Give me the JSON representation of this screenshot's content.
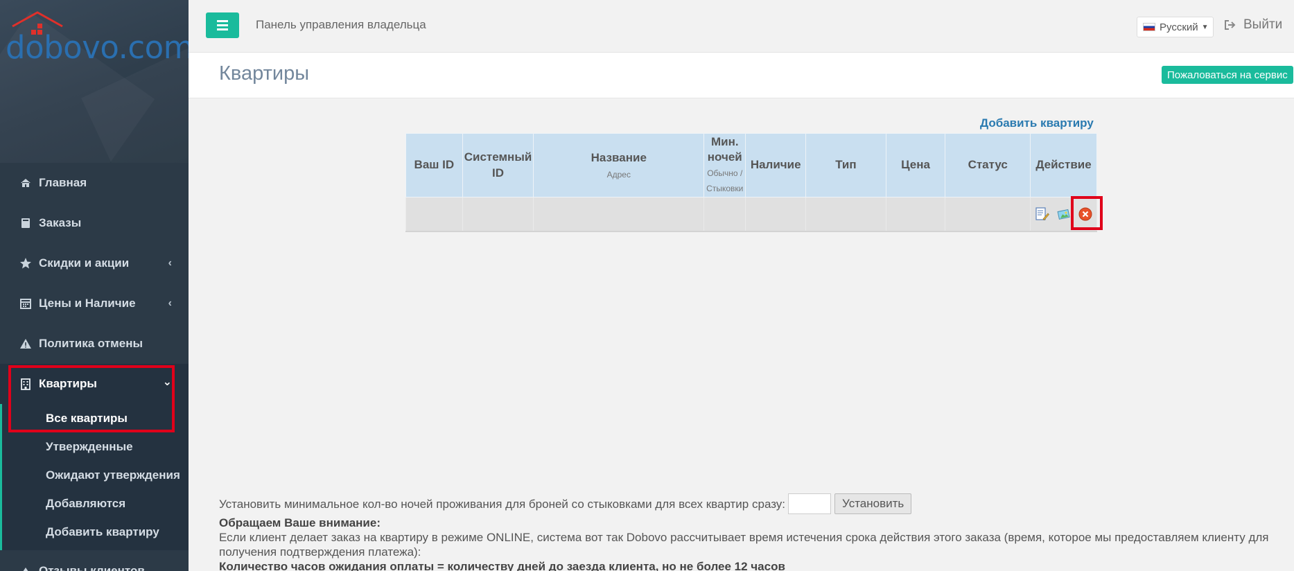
{
  "brand": {
    "logo_text": "dobovo.com"
  },
  "topbar": {
    "panel_title": "Панель управления владельца",
    "language": "Русский",
    "logout": "Выйти"
  },
  "page": {
    "title": "Квартиры",
    "complain_button": "Пожаловаться на сервис"
  },
  "sidebar": {
    "items": [
      {
        "label": "Главная",
        "icon": "home-icon"
      },
      {
        "label": "Заказы",
        "icon": "book-icon"
      },
      {
        "label": "Скидки и акции",
        "icon": "star-icon",
        "chevron": "‹"
      },
      {
        "label": "Цены и Наличие",
        "icon": "calendar-icon",
        "chevron": "‹"
      },
      {
        "label": "Политика отмены",
        "icon": "warning-icon"
      },
      {
        "label": "Квартиры",
        "icon": "building-icon",
        "chevron": "⌄"
      }
    ],
    "submenu": [
      "Все квартиры",
      "Утвержденные",
      "Ожидают утверждения",
      "Добавляются",
      "Добавить квартиру"
    ],
    "next_item": "Отзывы клиентов"
  },
  "table": {
    "add_link": "Добавить квартиру",
    "headers": {
      "your_id": "Ваш ID",
      "system_id": "Системный ID",
      "name": "Название",
      "name_sub": "Адрес",
      "min_nights": "Мин. ночей",
      "min_nights_sub": "Обычно / Стыковки",
      "availability": "Наличие",
      "type": "Тип",
      "price": "Цена",
      "status": "Статус",
      "action": "Действие"
    },
    "action_icons": [
      "edit-document-icon",
      "photo-icon",
      "delete-icon"
    ]
  },
  "bottom": {
    "min_nights_label": "Установить минимальное кол-во ночей проживания для броней со стыковками для всех квартир сразу:",
    "min_nights_value": "",
    "set_button": "Установить",
    "attention_title": "Обращаем Ваше внимание:",
    "attention_text": "Если клиент делает заказ на квартиру в режиме ONLINE, система вот так Dobovo рассчитывает время истечения срока действия этого заказа (время, которое мы предоставляем клиенту для получения подтверждения платежа):",
    "formula": "Количество часов ожидания оплаты = количеству дней до заезда клиента, но не более 12 часов"
  },
  "colors": {
    "accent": "#1abb9c",
    "sidebar": "#2c3a47",
    "header_cell": "#c9dff0",
    "highlight": "#e0001a",
    "link": "#2a7ab0"
  }
}
